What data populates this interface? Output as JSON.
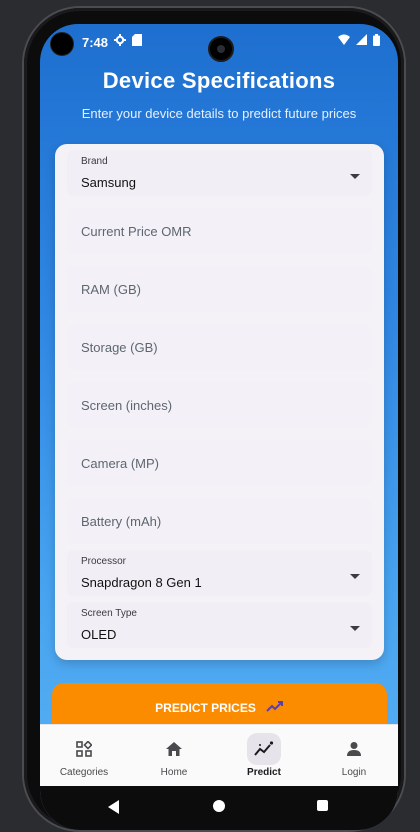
{
  "status": {
    "time": "7:48"
  },
  "header": {
    "title": "Device Specifications",
    "subtitle": "Enter your device details to predict future prices"
  },
  "form": {
    "brand": {
      "label": "Brand",
      "value": "Samsung"
    },
    "current_price": {
      "placeholder": "Current Price OMR"
    },
    "ram": {
      "placeholder": "RAM (GB)"
    },
    "storage": {
      "placeholder": "Storage (GB)"
    },
    "screen": {
      "placeholder": "Screen (inches)"
    },
    "camera": {
      "placeholder": "Camera (MP)"
    },
    "battery": {
      "placeholder": "Battery (mAh)"
    },
    "processor": {
      "label": "Processor",
      "value": "Snapdragon 8 Gen 1"
    },
    "screen_type": {
      "label": "Screen Type",
      "value": "OLED"
    }
  },
  "actions": {
    "predict_label": "PREDICT PRICES"
  },
  "nav": {
    "items": [
      {
        "label": "Categories",
        "icon": "categories-icon"
      },
      {
        "label": "Home",
        "icon": "home-icon"
      },
      {
        "label": "Predict",
        "icon": "trending-icon",
        "active": true
      },
      {
        "label": "Login",
        "icon": "person-icon"
      }
    ]
  },
  "colors": {
    "header_gradient_top": "#1e6fcf",
    "header_gradient_bottom": "#5ab2f3",
    "primary_action": "#fb8c00",
    "card_bg": "#f4f2f7"
  }
}
